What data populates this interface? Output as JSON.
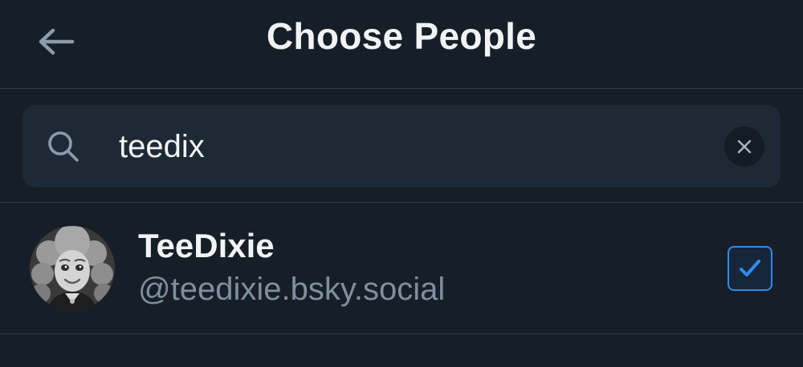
{
  "header": {
    "title": "Choose People",
    "back_icon": "arrow-left-icon"
  },
  "search": {
    "value": "teedix",
    "icon": "search-icon",
    "clear_icon": "close-icon"
  },
  "results": [
    {
      "display_name": "TeeDixie",
      "handle": "@teedixie.bsky.social",
      "selected": true
    }
  ],
  "colors": {
    "background": "#161e27",
    "search_background": "#1e2936",
    "accent": "#2f8bf0",
    "muted_text": "#7f8f9f",
    "divider": "#2e3a47"
  }
}
